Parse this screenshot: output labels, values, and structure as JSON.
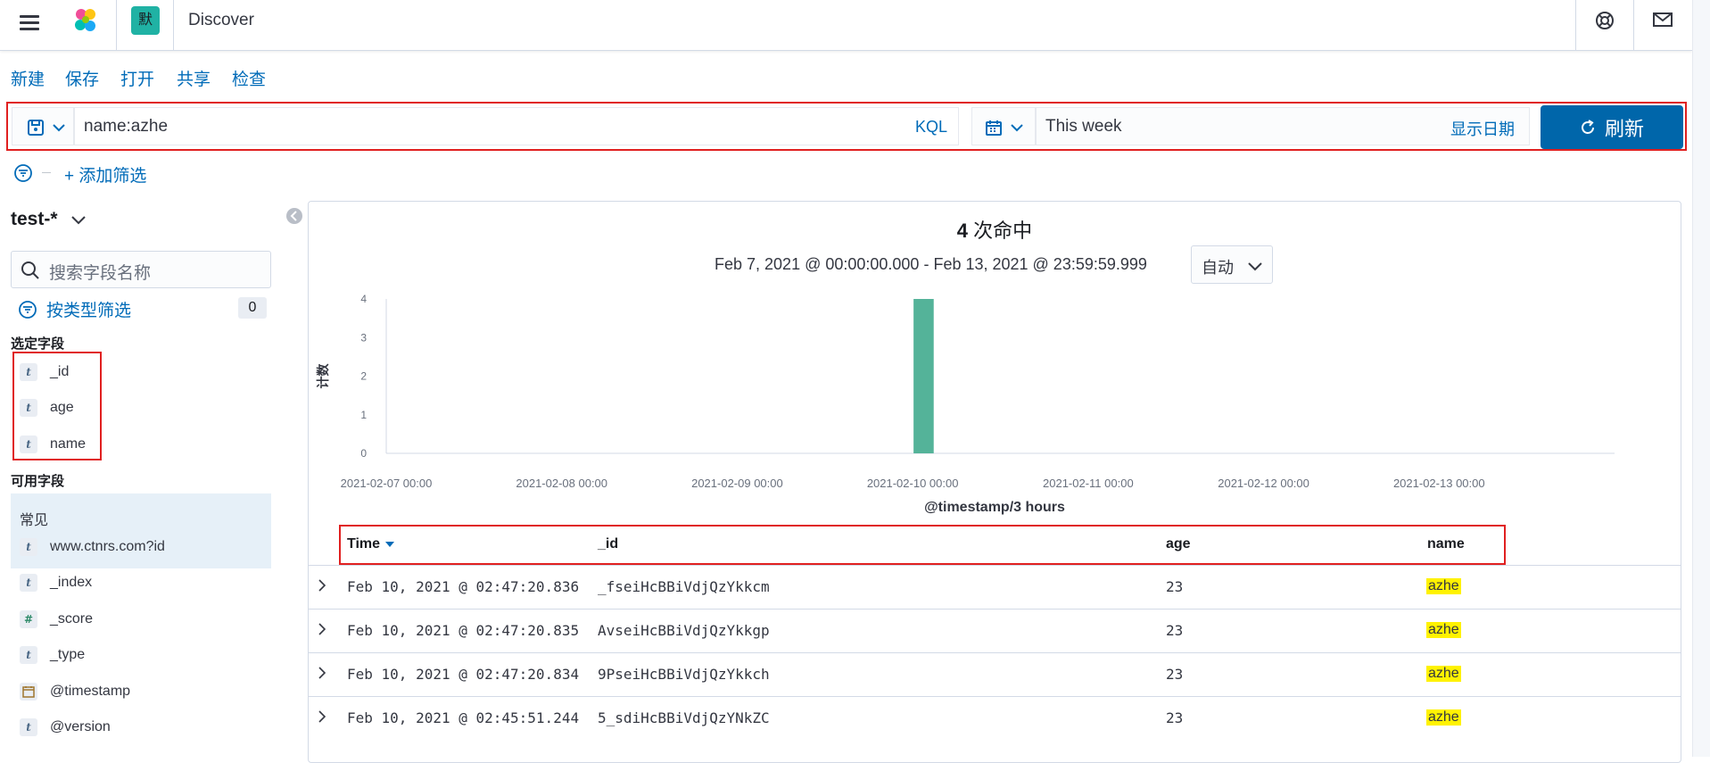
{
  "header": {
    "space_initial": "默",
    "app_title": "Discover",
    "icons": [
      "menu-icon",
      "elastic-logo-icon",
      "help-icon",
      "mail-icon"
    ]
  },
  "menu": {
    "new": "新建",
    "save": "保存",
    "open": "打开",
    "share": "共享",
    "inspect": "检查"
  },
  "query": {
    "value": "name:azhe",
    "language": "KQL",
    "time_range": "This week",
    "show_dates": "显示日期",
    "refresh": "刷新"
  },
  "filters": {
    "add_filter": "+ 添加筛选"
  },
  "sidebar": {
    "index_pattern": "test-*",
    "search_placeholder": "搜索字段名称",
    "filter_by_type": "按类型筛选",
    "filter_count": "0",
    "selected_title": "选定字段",
    "selected_fields": [
      {
        "type": "t",
        "name": "_id"
      },
      {
        "type": "t",
        "name": "age"
      },
      {
        "type": "t",
        "name": "name"
      }
    ],
    "available_title": "可用字段",
    "popular_title": "常见",
    "popular_fields": [
      {
        "type": "t",
        "name": "www.ctnrs.com?id"
      }
    ],
    "available_fields": [
      {
        "type": "t",
        "name": "_index"
      },
      {
        "type": "#",
        "name": "_score"
      },
      {
        "type": "t",
        "name": "_type"
      },
      {
        "type": "date",
        "name": "@timestamp"
      },
      {
        "type": "t",
        "name": "@version"
      }
    ]
  },
  "hits": {
    "count": "4",
    "label": "次命中",
    "range": "Feb 7, 2021 @ 00:00:00.000 - Feb 13, 2021 @ 23:59:59.999",
    "interval": "自动"
  },
  "chart_data": {
    "type": "bar",
    "title": "",
    "xlabel": "@timestamp/3 hours",
    "ylabel": "计数",
    "ylim": [
      0,
      4
    ],
    "yticks": [
      "0",
      "1",
      "2",
      "3",
      "4"
    ],
    "xticks": [
      "2021-02-07 00:00",
      "2021-02-08 00:00",
      "2021-02-09 00:00",
      "2021-02-10 00:00",
      "2021-02-11 00:00",
      "2021-02-12 00:00",
      "2021-02-13 00:00"
    ],
    "x_days": [
      0,
      7
    ],
    "bars": [
      {
        "x": "2021-02-10 00:00",
        "x_day": 3,
        "value": 4
      }
    ],
    "color": "#54b399",
    "grid": false
  },
  "table": {
    "columns": [
      "Time",
      "_id",
      "age",
      "name"
    ],
    "rows": [
      {
        "time": "Feb 10, 2021 @ 02:47:20.836",
        "id": "_fseiHcBBiVdjQzYkkcm",
        "age": "23",
        "name": "azhe"
      },
      {
        "time": "Feb 10, 2021 @ 02:47:20.835",
        "id": "AvseiHcBBiVdjQzYkkgp",
        "age": "23",
        "name": "azhe"
      },
      {
        "time": "Feb 10, 2021 @ 02:47:20.834",
        "id": "9PseiHcBBiVdjQzYkkch",
        "age": "23",
        "name": "azhe"
      },
      {
        "time": "Feb 10, 2021 @ 02:45:51.244",
        "id": "5_sdiHcBBiVdjQzYNkZC",
        "age": "23",
        "name": "azhe"
      }
    ]
  }
}
